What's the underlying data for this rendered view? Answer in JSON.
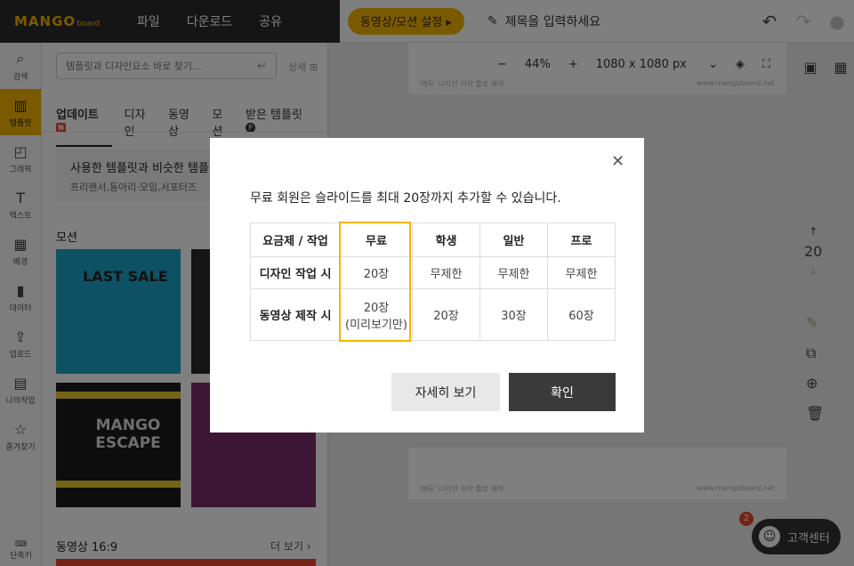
{
  "header": {
    "logo": "MANGO",
    "logo_sub": "board",
    "menu": [
      "파일",
      "다운로드",
      "공유"
    ],
    "video_motion_btn": "동영상/모션 설정 ▸",
    "title_placeholder": "제목을 입력하세요"
  },
  "sidebar": {
    "items": [
      {
        "icon": "search-icon",
        "glyph": "⌕",
        "label": "검색"
      },
      {
        "icon": "template-icon",
        "glyph": "▥",
        "label": "템플릿"
      },
      {
        "icon": "graphic-icon",
        "glyph": "◰",
        "label": "그래픽"
      },
      {
        "icon": "text-icon",
        "glyph": "T",
        "label": "텍스트"
      },
      {
        "icon": "background-icon",
        "glyph": "▦",
        "label": "배경"
      },
      {
        "icon": "data-icon",
        "glyph": "▮",
        "label": "데이터"
      },
      {
        "icon": "upload-icon",
        "glyph": "⇪",
        "label": "업로드"
      },
      {
        "icon": "my-work-icon",
        "glyph": "▤",
        "label": "나의작업"
      },
      {
        "icon": "favorites-icon",
        "glyph": "☆",
        "label": "즐겨찾기"
      }
    ],
    "shortcut_label": "단축키"
  },
  "panel": {
    "search_placeholder": "템플릿과 디자인요소 바로 찾기...",
    "detail": "상세",
    "tabs": [
      "업데이트",
      "디자인",
      "동영상",
      "모션",
      "받은 템플릿"
    ],
    "update_badge": "N",
    "received_badge": "P",
    "promo_title": "사용한 템플릿과 비슷한 템플",
    "promo_sub": "프리랜서,동아리·모임,서포터즈",
    "motion_section": "모션",
    "thumb_sale": "LAST SALE",
    "thumb_escape": "MANGO ESCAPE",
    "video_section": "동영상 16:9",
    "more": "더 보기 ›"
  },
  "canvas": {
    "zoom": "44%",
    "size": "1080 x 1080 px",
    "page_number": "20",
    "help_label": "고객센터",
    "help_count": "2",
    "slide_footer_left": "'에듀' 디자인 저작 툴로 제작",
    "slide_footer_right": "www.mangoboard.net"
  },
  "modal": {
    "message": "무료 회원은 슬라이드를 최대 20장까지 추가할 수 있습니다.",
    "columns": [
      "요금제 / 작업",
      "무료",
      "학생",
      "일반",
      "프로"
    ],
    "rows": [
      {
        "label": "디자인 작업 시",
        "free": "20장",
        "student": "무제한",
        "general": "무제한",
        "pro": "무제한"
      },
      {
        "label": "동영상 제작 시",
        "free": "20장",
        "free_note": "(미리보기만)",
        "student": "20장",
        "general": "30장",
        "pro": "60장"
      }
    ],
    "detail_button": "자세히 보기",
    "confirm_button": "확인"
  },
  "colors": {
    "accent": "#f5b400",
    "dark": "#2b2b2b",
    "badge": "#e8472a"
  }
}
